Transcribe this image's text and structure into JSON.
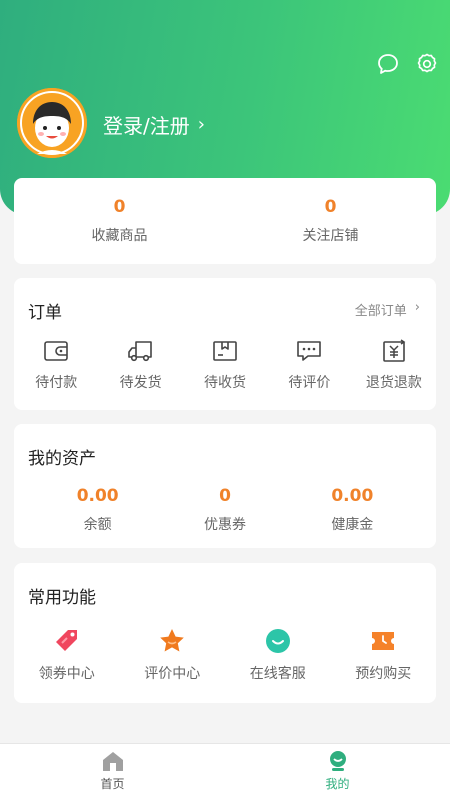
{
  "colors": {
    "accent": "#2fae7e",
    "number": "#f0822a"
  },
  "header": {
    "login_label": "登录/注册",
    "icons": [
      "message-icon",
      "settings-icon"
    ]
  },
  "stats": [
    {
      "value": "0",
      "label": "收藏商品"
    },
    {
      "value": "0",
      "label": "关注店铺"
    }
  ],
  "orders": {
    "title": "订单",
    "all_link": "全部订单",
    "items": [
      {
        "label": "待付款",
        "icon": "wallet-icon"
      },
      {
        "label": "待发货",
        "icon": "truck-icon"
      },
      {
        "label": "待收货",
        "icon": "package-icon"
      },
      {
        "label": "待评价",
        "icon": "comment-icon"
      },
      {
        "label": "退货退款",
        "icon": "refund-icon"
      }
    ]
  },
  "assets": {
    "title": "我的资产",
    "items": [
      {
        "value": "0.00",
        "label": "余额"
      },
      {
        "value": "0",
        "label": "优惠券"
      },
      {
        "value": "0.00",
        "label": "健康金"
      }
    ]
  },
  "functions": {
    "title": "常用功能",
    "items": [
      {
        "label": "领券中心",
        "icon": "coupon-tag-icon",
        "color": "#f0465e"
      },
      {
        "label": "评价中心",
        "icon": "star-icon",
        "color": "#f07a1e"
      },
      {
        "label": "在线客服",
        "icon": "customer-service-icon",
        "color": "#2cc5a8"
      },
      {
        "label": "预约购买",
        "icon": "ticket-clock-icon",
        "color": "#f5822a"
      }
    ]
  },
  "tabbar": [
    {
      "label": "首页",
      "icon": "home-icon"
    },
    {
      "label": "我的",
      "icon": "profile-icon",
      "active": true
    }
  ]
}
